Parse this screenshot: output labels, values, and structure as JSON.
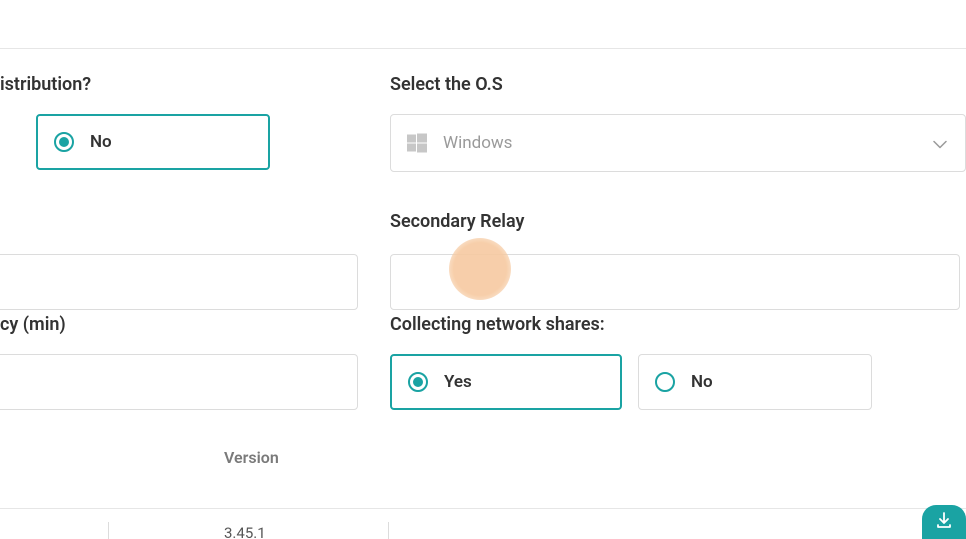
{
  "distribution": {
    "label_partial": "istribution?",
    "option_no": "No"
  },
  "os": {
    "label": "Select the O.S",
    "selected": "Windows"
  },
  "secondary_relay": {
    "label": "Secondary Relay",
    "value": ""
  },
  "cy_min": {
    "label_partial": "cy (min)",
    "value": ""
  },
  "collecting_shares": {
    "label": "Collecting network shares:",
    "option_yes": "Yes",
    "option_no": "No"
  },
  "table": {
    "col_version": "Version",
    "row_version": "3.45.1"
  },
  "colors": {
    "accent": "#1aa3a3",
    "highlight": "#f6c9a0"
  }
}
